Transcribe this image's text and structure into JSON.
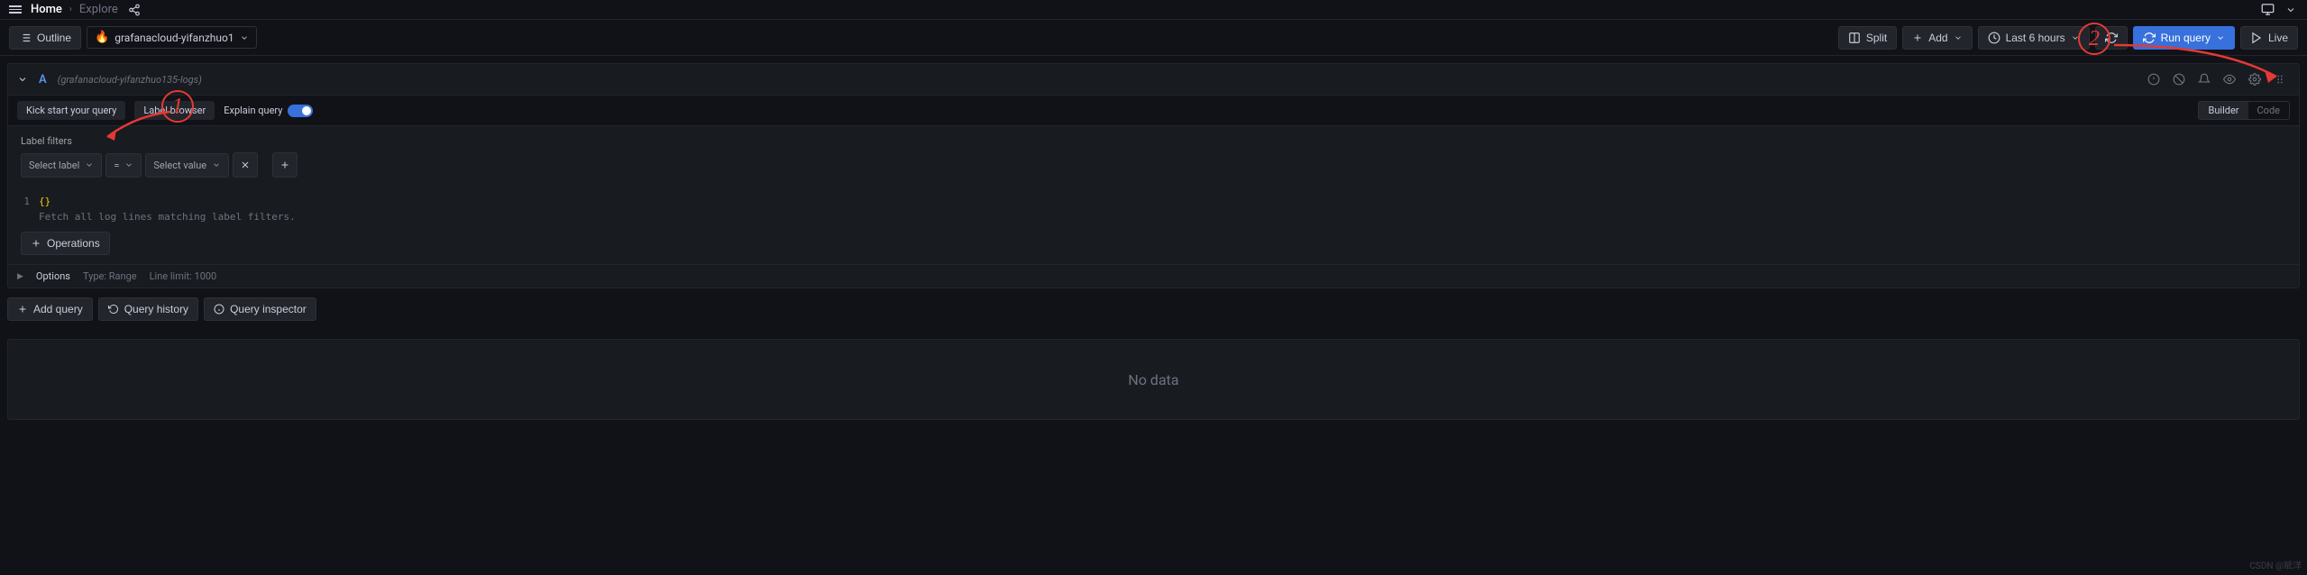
{
  "nav": {
    "home": "Home",
    "current": "Explore"
  },
  "toolbar": {
    "outline": "Outline",
    "datasource": "grafanacloud-yifanzhuo1",
    "split": "Split",
    "add": "Add",
    "timerange": "Last 6 hours",
    "run_query": "Run query",
    "live": "Live"
  },
  "query": {
    "letter": "A",
    "ds_hint": "(grafanacloud-yifanzhuo135-logs)",
    "kick_start": "Kick start your query",
    "label_browser": "Label browser",
    "explain": "Explain query",
    "builder": "Builder",
    "code": "Code",
    "label_filters": "Label filters",
    "select_label": "Select label",
    "eq": "=",
    "select_value": "Select value",
    "line_num": "1",
    "code_braces": "{}",
    "code_hint": "Fetch all log lines matching label filters.",
    "operations": "Operations",
    "options": "Options",
    "type": "Type: Range",
    "line_limit": "Line limit: 1000"
  },
  "actions": {
    "add_query": "Add query",
    "query_history": "Query history",
    "query_inspector": "Query inspector"
  },
  "result": {
    "no_data": "No data"
  },
  "annotations": {
    "n1": "1",
    "n2": "2"
  },
  "watermark": "CSDN @赋洋"
}
